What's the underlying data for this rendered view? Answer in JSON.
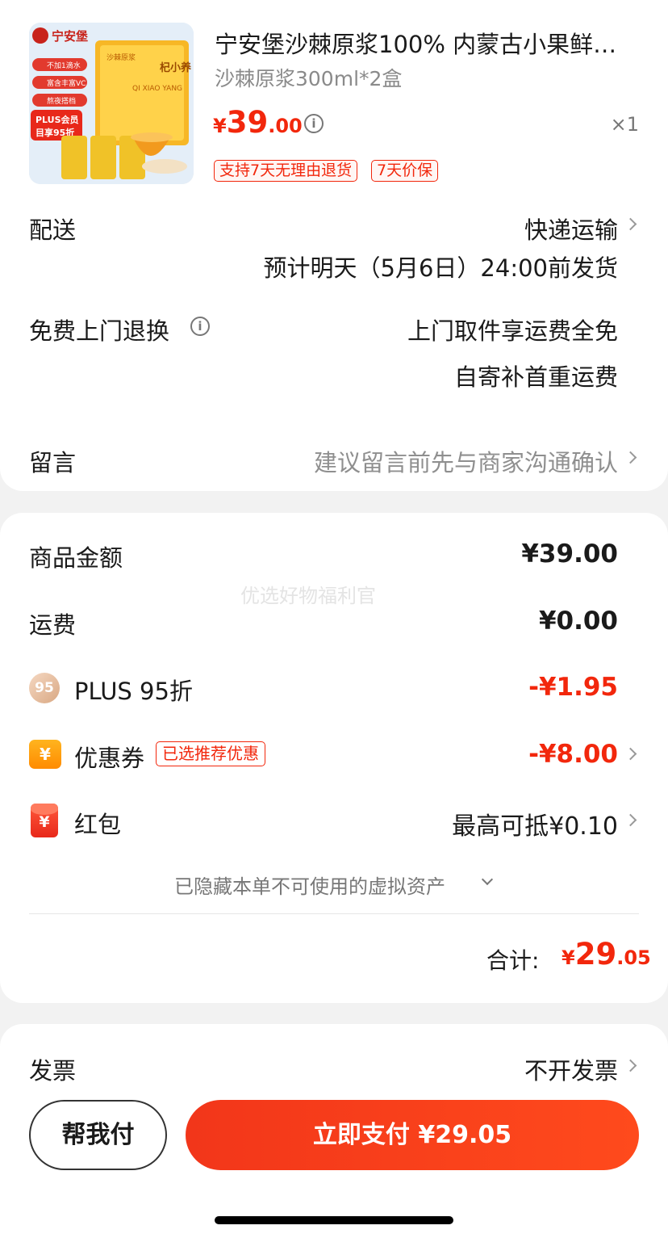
{
  "product": {
    "name": "宁安堡沙棘原浆100% 内蒙古小果鲜…",
    "spec": "沙棘原浆300ml*2盒",
    "price_currency": "¥",
    "price_int": "39",
    "price_dec": ".00",
    "qty": "×1",
    "tags": [
      "支持7天无理由退货",
      "7天价保"
    ],
    "image_text": {
      "brand": "宁安堡",
      "badges": [
        "不加1滴水",
        "富含丰富VC",
        "熬夜搭档"
      ],
      "plus": "PLUS会员",
      "plus_discount": "目享95折",
      "box_title": "杞小养",
      "box_pinyin": "QI XIAO YANG",
      "box_sub": "沙棘原浆"
    }
  },
  "delivery": {
    "label": "配送",
    "method": "快递运输",
    "estimate": "预计明天（5月6日）24:00前发货"
  },
  "return_service": {
    "label": "免费上门退换",
    "line1": "上门取件享运费全免",
    "line2": "自寄补首重运费"
  },
  "message": {
    "label": "留言",
    "placeholder": "建议留言前先与商家沟通确认"
  },
  "summary": {
    "watermark": "优选好物福利官",
    "goods_label": "商品金额",
    "goods_value": "¥39.00",
    "shipping_label": "运费",
    "shipping_value": "¥0.00",
    "plus_icon": "95",
    "plus_label": "PLUS 95折",
    "plus_value": "-¥1.95",
    "coupon_icon": "¥",
    "coupon_label": "优惠券",
    "coupon_badge": "已选推荐优惠",
    "coupon_value": "-¥8.00",
    "redpacket_icon": "¥",
    "redpacket_label": "红包",
    "redpacket_value": "最高可抵¥0.10",
    "hidden_assets": "已隐藏本单不可使用的虚拟资产",
    "total_label": "合计:",
    "total_currency": "¥",
    "total_int": "29",
    "total_dec": ".05"
  },
  "invoice": {
    "label": "发票",
    "value": "不开发票"
  },
  "actions": {
    "help_pay": "帮我付",
    "pay_now": "立即支付 ¥29.05"
  },
  "colors": {
    "accent": "#f2270c",
    "muted": "#8f8f8f"
  }
}
